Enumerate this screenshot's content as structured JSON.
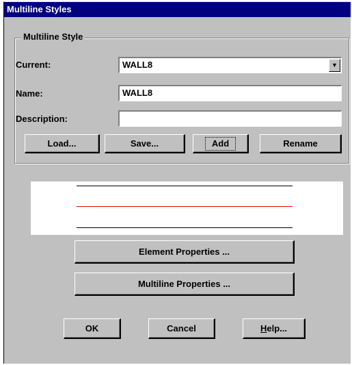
{
  "window": {
    "title": "Multiline Styles"
  },
  "group": {
    "legend": "Multiline Style"
  },
  "current": {
    "label": "Current:",
    "value": "WALL8"
  },
  "name": {
    "label": "Name:",
    "value": "WALL8"
  },
  "description": {
    "label": "Description:",
    "value": ""
  },
  "buttons": {
    "load": "Load...",
    "save": "Save...",
    "add": "Add",
    "rename": "Rename",
    "element_properties": "Element Properties ...",
    "multiline_properties": "Multiline Properties ...",
    "ok": "OK",
    "cancel": "Cancel",
    "help_prefix": "H",
    "help_rest": "elp..."
  },
  "preview": {
    "lines": [
      {
        "color": "#000000"
      },
      {
        "color": "#e00000"
      },
      {
        "color": "#000000"
      }
    ]
  },
  "colors": {
    "title_bar": "#000080",
    "dialog_bg": "#c0c0c0",
    "preview_bg": "#ffffff"
  }
}
